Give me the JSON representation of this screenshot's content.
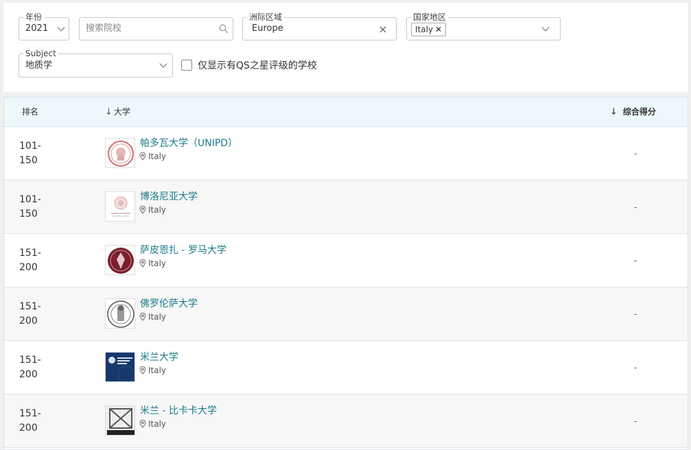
{
  "filters": {
    "year": {
      "legend": "年份",
      "value": "2021"
    },
    "search": {
      "placeholder": "搜索院校"
    },
    "region": {
      "legend": "洲际区域",
      "value": "Europe"
    },
    "country": {
      "legend": "国家地区",
      "tag": "Italy"
    },
    "subject": {
      "legend": "Subject",
      "value": "地质学"
    },
    "qs_stars_label": "仅显示有QS之星评级的学校"
  },
  "table": {
    "headers": {
      "rank": "排名",
      "university": "大学",
      "score": "综合得分"
    },
    "rows": [
      {
        "rank_top": "101-",
        "rank_bottom": "150",
        "name": "帕多瓦大学（UNIPD）",
        "location": "Italy",
        "score": "-"
      },
      {
        "rank_top": "101-",
        "rank_bottom": "150",
        "name": "博洛尼亚大学",
        "location": "Italy",
        "score": "-"
      },
      {
        "rank_top": "151-",
        "rank_bottom": "200",
        "name": "萨皮恩扎 - 罗马大学",
        "location": "Italy",
        "score": "-"
      },
      {
        "rank_top": "151-",
        "rank_bottom": "200",
        "name": "佛罗伦萨大学",
        "location": "Italy",
        "score": "-"
      },
      {
        "rank_top": "151-",
        "rank_bottom": "200",
        "name": "米兰大学",
        "location": "Italy",
        "score": "-"
      },
      {
        "rank_top": "151-",
        "rank_bottom": "200",
        "name": "米兰 - 比卡卡大学",
        "location": "Italy",
        "score": "-"
      }
    ]
  },
  "icons": {
    "sort": "arrow-down-icon",
    "location": "location-pin-icon",
    "search": "search-icon",
    "clear": "close-icon",
    "dropdown": "chevron-down-icon"
  },
  "colors": {
    "accent": "#1a7a8a",
    "header_bg": "#eef7fb",
    "alt_row_bg": "#f7f7f7"
  }
}
